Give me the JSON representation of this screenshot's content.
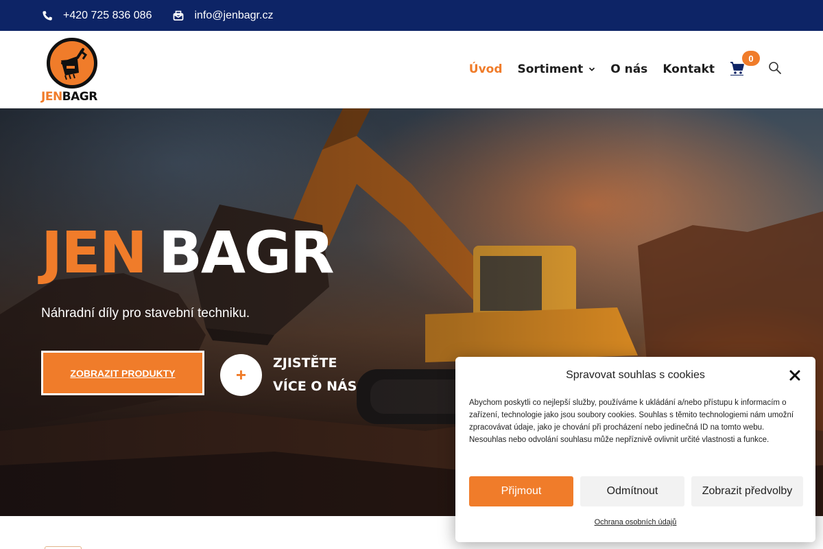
{
  "topbar": {
    "phone": "+420 725 836 086",
    "email": "info@jenbagr.cz",
    "icons": [
      "phone-icon",
      "envelope-icon"
    ],
    "background": "#0d2466"
  },
  "logo": {
    "part1": "JEN",
    "part2": "BAGR",
    "icon": "excavator-bucket-icon"
  },
  "nav": {
    "items": [
      {
        "label": "Úvod",
        "active": true
      },
      {
        "label": "Sortiment",
        "has_dropdown": true
      },
      {
        "label": "O nás"
      },
      {
        "label": "Kontakt"
      }
    ],
    "cart_count": "0",
    "cart_icon": "cart-icon",
    "search_icon": "search-icon"
  },
  "hero": {
    "title_part1": "JEN",
    "title_part2": "BAGR",
    "subtitle": "Náhradní díly pro stavební techniku.",
    "primary_button": "ZOBRAZIT PRODUKTY",
    "secondary_line1": "ZJISTĚTE",
    "secondary_line2": "VÍCE O NÁS",
    "secondary_icon": "+"
  },
  "cookie": {
    "title": "Spravovat souhlas s cookies",
    "body": "Abychom poskytli co nejlepší služby, používáme k ukládání a/nebo přístupu k informacím o zařízení, technologie jako jsou soubory cookies. Souhlas s těmito technologiemi nám umožní zpracovávat údaje, jako je chování při procházení nebo jedinečná ID na tomto webu. Nesouhlas nebo odvolání souhlasu může nepříznivě ovlivnit určité vlastnosti a funkce.",
    "accept": "Přijmout",
    "deny": "Odmítnout",
    "preferences": "Zobrazit předvolby",
    "privacy_link": "Ochrana osobních údajů"
  },
  "colors": {
    "accent": "#f07c2a",
    "navy": "#0d2466",
    "text": "#1d1d1d"
  }
}
